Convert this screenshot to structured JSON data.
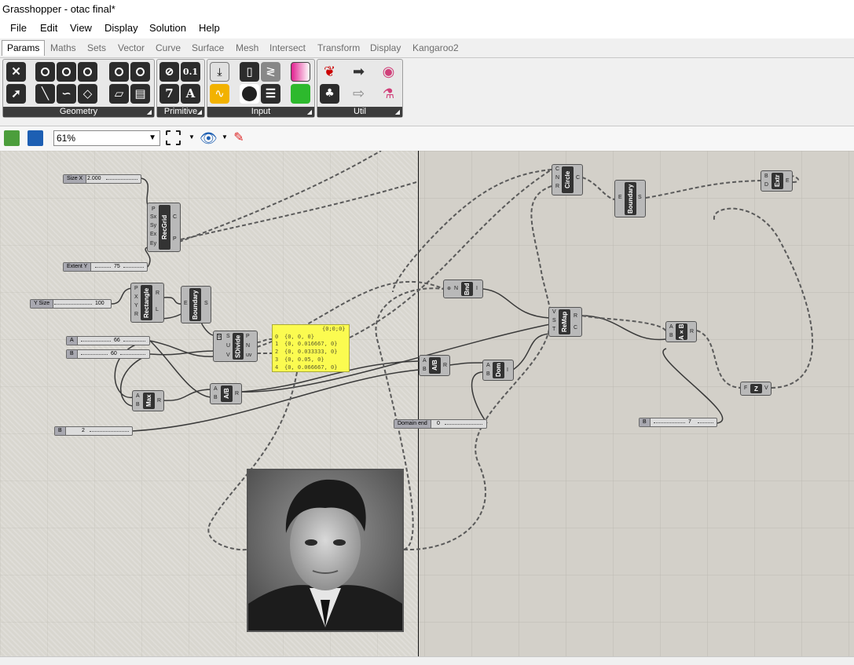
{
  "window": {
    "title": "Grasshopper - otac final*"
  },
  "menu": [
    "File",
    "Edit",
    "View",
    "Display",
    "Solution",
    "Help"
  ],
  "tabs": [
    "Params",
    "Maths",
    "Sets",
    "Vector",
    "Curve",
    "Surface",
    "Mesh",
    "Intersect",
    "Transform",
    "Display",
    "Kangaroo2"
  ],
  "ribbon": {
    "groups": [
      "Geometry",
      "Primitive",
      "Input",
      "Util"
    ],
    "primitive_glyphs": [
      "0.1",
      "7",
      "A"
    ]
  },
  "toolbar": {
    "zoom": "61%"
  },
  "canvas": {
    "sliders": {
      "size_x": {
        "label": "Size X",
        "value": "2.000"
      },
      "extent_y": {
        "label": "Extent Y",
        "value": "75"
      },
      "y_size": {
        "label": "Y Size",
        "value": "100"
      },
      "a": {
        "label": "A",
        "value": "66"
      },
      "b": {
        "label": "B",
        "value": "60"
      },
      "b2": {
        "label": "B",
        "value": "2"
      },
      "domain_end": {
        "label": "Domain end",
        "value": "0"
      },
      "b3": {
        "label": "B",
        "value": "7"
      }
    },
    "components": {
      "recgrid": {
        "name": "RecGrid",
        "inputs": [
          "P",
          "Sx",
          "Sy",
          "Ex",
          "Ey"
        ],
        "outputs": [
          "C",
          "P"
        ]
      },
      "rectangle": {
        "name": "Rectangle",
        "inputs": [
          "P",
          "X",
          "Y",
          "R"
        ],
        "outputs": [
          "R",
          "L"
        ]
      },
      "boundary1": {
        "name": "Boundary",
        "inputs": [
          "E"
        ],
        "outputs": [
          "S"
        ]
      },
      "sdivide": {
        "name": "SDivide",
        "inputs": [
          "S",
          "U",
          "V"
        ],
        "outputs": [
          "P",
          "N",
          "uv"
        ]
      },
      "max": {
        "name": "Max",
        "inputs": [
          "A",
          "B"
        ],
        "outputs": [
          "R"
        ]
      },
      "div1": {
        "name": "A/B",
        "inputs": [
          "A",
          "B"
        ],
        "outputs": [
          "R"
        ]
      },
      "div2": {
        "name": "A/B",
        "inputs": [
          "A",
          "B"
        ],
        "outputs": [
          "R"
        ]
      },
      "bnd": {
        "name": "Bnd",
        "inputs": [
          "N"
        ],
        "outputs": [
          "I"
        ]
      },
      "dom": {
        "name": "Dom",
        "inputs": [
          "A",
          "B"
        ],
        "outputs": [
          "I"
        ]
      },
      "remap": {
        "name": "ReMap",
        "inputs": [
          "V",
          "S",
          "T"
        ],
        "outputs": [
          "R",
          "C"
        ]
      },
      "circle": {
        "name": "Circle",
        "inputs": [
          "C",
          "N",
          "R"
        ],
        "outputs": [
          "C"
        ]
      },
      "boundary2": {
        "name": "Boundary",
        "inputs": [
          "E"
        ],
        "outputs": [
          "S"
        ]
      },
      "extr": {
        "name": "Extr",
        "inputs": [
          "B",
          "D"
        ],
        "outputs": [
          "E"
        ]
      },
      "mult": {
        "name": "A×B",
        "inputs": [
          "A",
          "B"
        ],
        "outputs": [
          "R"
        ]
      },
      "unitz": {
        "name": "Z",
        "inputs": [
          "F"
        ],
        "outputs": [
          "V"
        ]
      }
    },
    "panel": {
      "path": "{0;0;0}",
      "rows": [
        {
          "index": "0",
          "text": "{0, 0, 0}"
        },
        {
          "index": "1",
          "text": "{0, 0.016667, 0}"
        },
        {
          "index": "2",
          "text": "{0, 0.033333, 0}"
        },
        {
          "index": "3",
          "text": "{0, 0.05, 0}"
        },
        {
          "index": "4",
          "text": "{0, 0.066667, 0}"
        }
      ]
    }
  },
  "colors": {
    "panel_yellow": "#fbfb50",
    "canvas": "#d3d0c9",
    "component_body": "#b9b9b9"
  }
}
